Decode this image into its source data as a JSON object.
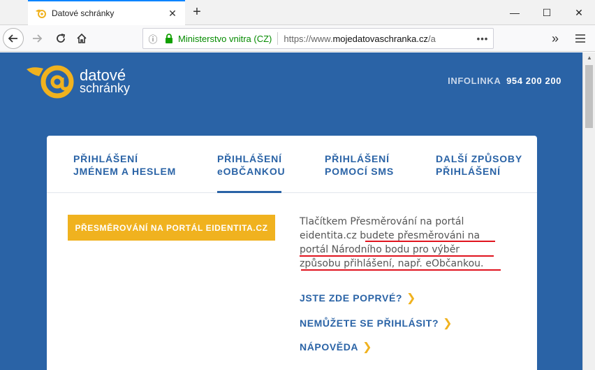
{
  "browser": {
    "tab_title": "Datové schránky",
    "url_org": "Ministerstvo vnitra (CZ)",
    "url_prefix": "https://www.",
    "url_domain": "mojedatovaschranka.cz",
    "url_suffix": "/a"
  },
  "header": {
    "logo_line1": "datové",
    "logo_line2": "schránky",
    "infolinka_label": "INFOLINKA",
    "infolinka_number": "954 200 200"
  },
  "tabs": [
    {
      "line1": "PŘIHLÁŠENÍ",
      "line2": "JMÉNEM A HESLEM"
    },
    {
      "line1": "PŘIHLÁŠENÍ",
      "line2": "eOBČANKOU"
    },
    {
      "line1": "PŘIHLÁŠENÍ",
      "line2": "POMOCÍ SMS"
    },
    {
      "line1": "DALŠÍ ZPŮSOBY",
      "line2": "PŘIHLÁŠENÍ"
    }
  ],
  "content": {
    "redirect_button": "PŘESMĚROVÁNÍ NA PORTÁL EIDENTITA.CZ",
    "desc_line1": "Tlačítkem Přesměrování na portál",
    "desc_line2": "eidentita.cz budete přesměrováni na",
    "desc_line3": "portál Národního bodu pro výběr",
    "desc_line4": "způsobu přihlášení, např. eObčankou.",
    "link_first": "JSTE ZDE POPRVÉ?",
    "link_cannot": "NEMŮŽETE SE PŘIHLÁSIT?",
    "link_help": "NÁPOVĚDA"
  },
  "colors": {
    "page_bg": "#2a63a6",
    "accent": "#f0b21f",
    "annotation": "#e0141e"
  }
}
